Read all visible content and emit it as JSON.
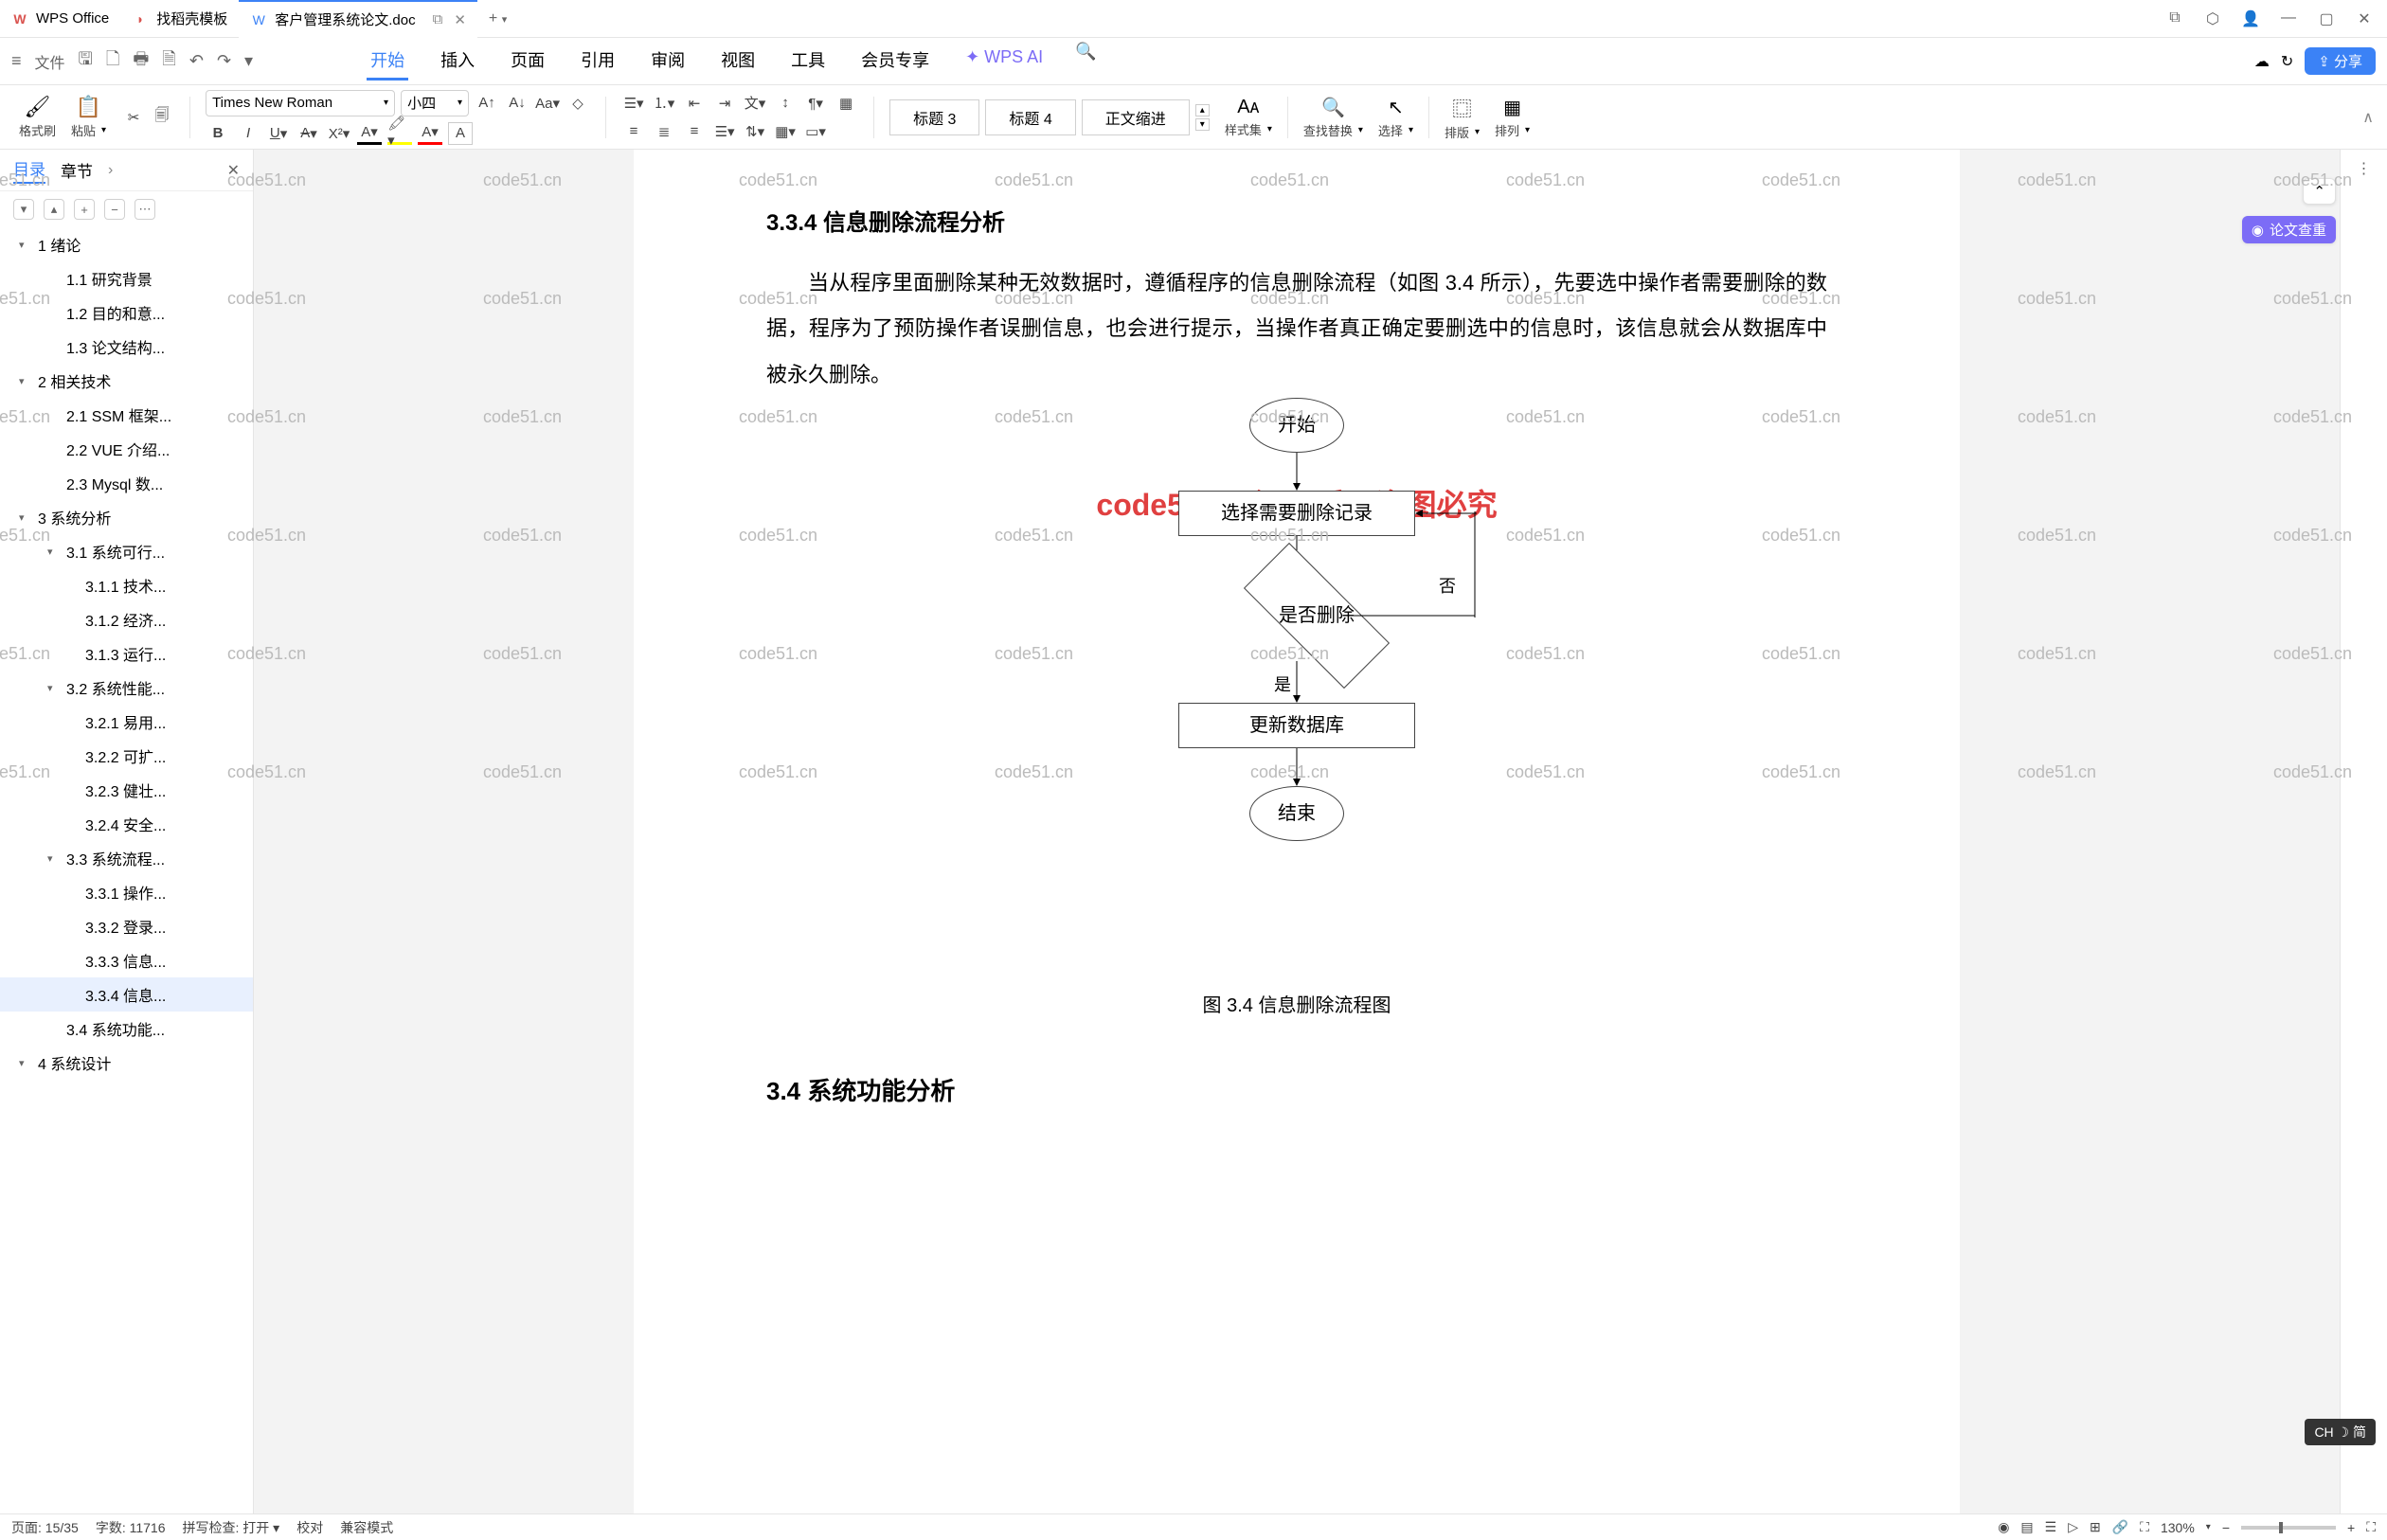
{
  "titlebar": {
    "tabs": [
      {
        "icon": "W",
        "label": "WPS Office"
      },
      {
        "icon": "D",
        "label": "找稻壳模板"
      },
      {
        "icon": "W",
        "label": "客户管理系统论文.doc"
      }
    ],
    "tab_add": "+",
    "win_icons": [
      "⧉",
      "⬡",
      "👤",
      "—",
      "▢",
      "✕"
    ]
  },
  "menubar": {
    "file_label": "文件",
    "tabs": [
      "开始",
      "插入",
      "页面",
      "引用",
      "审阅",
      "视图",
      "工具",
      "会员专享"
    ],
    "ai_label": "WPS AI",
    "share_label": "分享"
  },
  "ribbon": {
    "format_painter": "格式刷",
    "paste": "粘贴",
    "font_name": "Times New Roman",
    "font_size": "小四",
    "styles": [
      "标题 3",
      "标题 4",
      "正文缩进"
    ],
    "style_set": "样式集",
    "find_replace": "查找替换",
    "select": "选择",
    "arrange": "排版",
    "order": "排列"
  },
  "sidebar": {
    "tab_toc": "目录",
    "tab_chapter": "章节",
    "items": [
      {
        "lvl": 1,
        "caret": true,
        "text": "1 绪论"
      },
      {
        "lvl": 2,
        "text": "1.1 研究背景"
      },
      {
        "lvl": 2,
        "text": "1.2 目的和意..."
      },
      {
        "lvl": 2,
        "text": "1.3 论文结构..."
      },
      {
        "lvl": 1,
        "caret": true,
        "text": "2 相关技术"
      },
      {
        "lvl": 2,
        "text": "2.1 SSM 框架..."
      },
      {
        "lvl": 2,
        "text": "2.2 VUE 介绍..."
      },
      {
        "lvl": 2,
        "text": "2.3 Mysql 数..."
      },
      {
        "lvl": 1,
        "caret": true,
        "text": "3 系统分析"
      },
      {
        "lvl": 2,
        "caret": true,
        "text": "3.1  系统可行..."
      },
      {
        "lvl": 3,
        "text": "3.1.1  技术..."
      },
      {
        "lvl": 3,
        "text": "3.1.2  经济..."
      },
      {
        "lvl": 3,
        "text": "3.1.3  运行..."
      },
      {
        "lvl": 2,
        "caret": true,
        "text": "3.2  系统性能..."
      },
      {
        "lvl": 3,
        "text": "3.2.1  易用..."
      },
      {
        "lvl": 3,
        "text": "3.2.2  可扩..."
      },
      {
        "lvl": 3,
        "text": "3.2.3  健壮..."
      },
      {
        "lvl": 3,
        "text": "3.2.4  安全..."
      },
      {
        "lvl": 2,
        "caret": true,
        "text": "3.3  系统流程..."
      },
      {
        "lvl": 3,
        "text": "3.3.1  操作..."
      },
      {
        "lvl": 3,
        "text": "3.3.2  登录..."
      },
      {
        "lvl": 3,
        "text": "3.3.3  信息..."
      },
      {
        "lvl": 3,
        "text": "3.3.4  信息...",
        "active": true
      },
      {
        "lvl": 2,
        "text": "3.4  系统功能..."
      },
      {
        "lvl": 1,
        "caret": true,
        "text": "4 系统设计"
      }
    ]
  },
  "doc": {
    "h4": "3.3.4  信息删除流程分析",
    "p1": "当从程序里面删除某种无效数据时，遵循程序的信息删除流程（如图 3.4 所示），先要选中操作者需要删除的数据，程序为了预防操作者误删信息，也会进行提示，当操作者真正确定要删选中的信息时，该信息就会从数据库中被永久删除。",
    "fc": {
      "start": "开始",
      "select": "选择需要删除记录",
      "cond": "是否删除",
      "yes": "是",
      "no": "否",
      "update": "更新数据库",
      "end": "结束"
    },
    "caption": "图 3.4  信息删除流程图",
    "h3": "3.4  系统功能分析",
    "centerwm": "code51.cn-源码乐园盗图必究",
    "wm": "code51.cn"
  },
  "rightfloat": {
    "check": "论文查重"
  },
  "statusbar": {
    "page": "页面: 15/35",
    "words": "字数: 11716",
    "spell": "拼写检查: 打开",
    "proof": "校对",
    "compat": "兼容模式",
    "zoom": "130%"
  },
  "ime": "CH ☽ 简"
}
